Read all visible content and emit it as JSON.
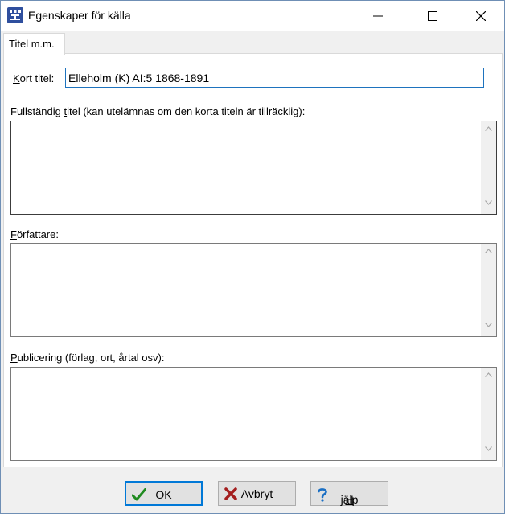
{
  "window": {
    "title": "Egenskaper för källa"
  },
  "tabs": [
    {
      "label": "Titel m.m."
    }
  ],
  "short_title": {
    "label_ul": "K",
    "label_rest": "ort titel:",
    "value": "Elleholm (K) AI:5 1868-1891"
  },
  "full_title": {
    "label_pre": "Fullständig ",
    "label_ul": "t",
    "label_post": "itel (kan utelämnas om den korta titeln är tillräcklig):",
    "value": ""
  },
  "author": {
    "label_ul": "F",
    "label_rest": "örfattare:",
    "value": ""
  },
  "publishing": {
    "label_ul": "P",
    "label_rest": "ublicering (förlag, ort, årtal osv):",
    "value": ""
  },
  "buttons": {
    "ok": "OK",
    "cancel": "Avbryt",
    "help_ul": "H",
    "help_rest": "jälp"
  },
  "colors": {
    "accent": "#0078d7",
    "ok_check": "#1f8a1f",
    "cancel_x": "#a41e1e",
    "help_q": "#1a6fc4"
  }
}
